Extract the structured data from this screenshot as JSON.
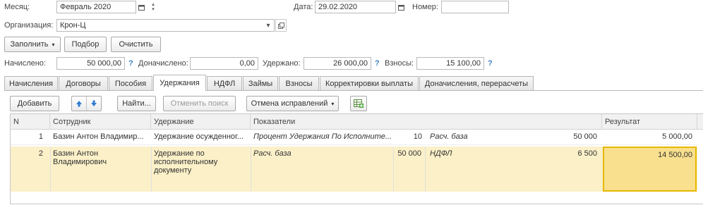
{
  "header": {
    "month_label": "Месяц:",
    "month_value": "Февраль 2020",
    "date_label": "Дата:",
    "date_value": "29.02.2020",
    "number_label": "Номер:",
    "number_value": "",
    "org_label": "Организация:",
    "org_value": "Крон-Ц"
  },
  "toolbar": {
    "fill_label": "Заполнить",
    "pick_label": "Подбор",
    "clear_label": "Очистить"
  },
  "totals": {
    "accrued_label": "Начислено:",
    "accrued_value": "50 000,00",
    "additional_label": "Доначислено:",
    "additional_value": "0,00",
    "withheld_label": "Удержано:",
    "withheld_value": "26 000,00",
    "contrib_label": "Взносы:",
    "contrib_value": "15 100,00",
    "help_mark": "?"
  },
  "tabs": [
    {
      "label": "Начисления"
    },
    {
      "label": "Договоры"
    },
    {
      "label": "Пособия"
    },
    {
      "label": "Удержания"
    },
    {
      "label": "НДФЛ"
    },
    {
      "label": "Займы"
    },
    {
      "label": "Взносы"
    },
    {
      "label": "Корректировки выплаты"
    },
    {
      "label": "Доначисления, перерасчеты"
    }
  ],
  "grid_toolbar": {
    "add_label": "Добавить",
    "find_label": "Найти...",
    "cancel_search_label": "Отменить поиск",
    "cancel_fix_label": "Отмена исправлений"
  },
  "table": {
    "columns": [
      "N",
      "Сотрудник",
      "Удержание",
      "Показатели",
      "Результат"
    ],
    "rows": [
      {
        "n": "1",
        "employee": "Базин Антон Владимир...",
        "deduction": "Удержание осужденног...",
        "ind1_name": "Процент Удержания По Исполните...",
        "ind1_value": "10",
        "ind2_name": "Расч. база",
        "ind2_value": "50 000",
        "result": "5 000,00"
      },
      {
        "n": "2",
        "employee": "Базин Антон Владимирович",
        "deduction": "Удержание по исполнительному документу",
        "ind1_name": "Расч. база",
        "ind1_value": "50 000",
        "ind2_name": "НДФЛ",
        "ind2_value": "6 500",
        "result": "14 500,00"
      }
    ]
  },
  "colors": {
    "selected_row": "#fbf0c8",
    "selected_cell": "#f9e08e",
    "selected_cell_border": "#e6b800",
    "help_blue": "#3c7fc0"
  }
}
